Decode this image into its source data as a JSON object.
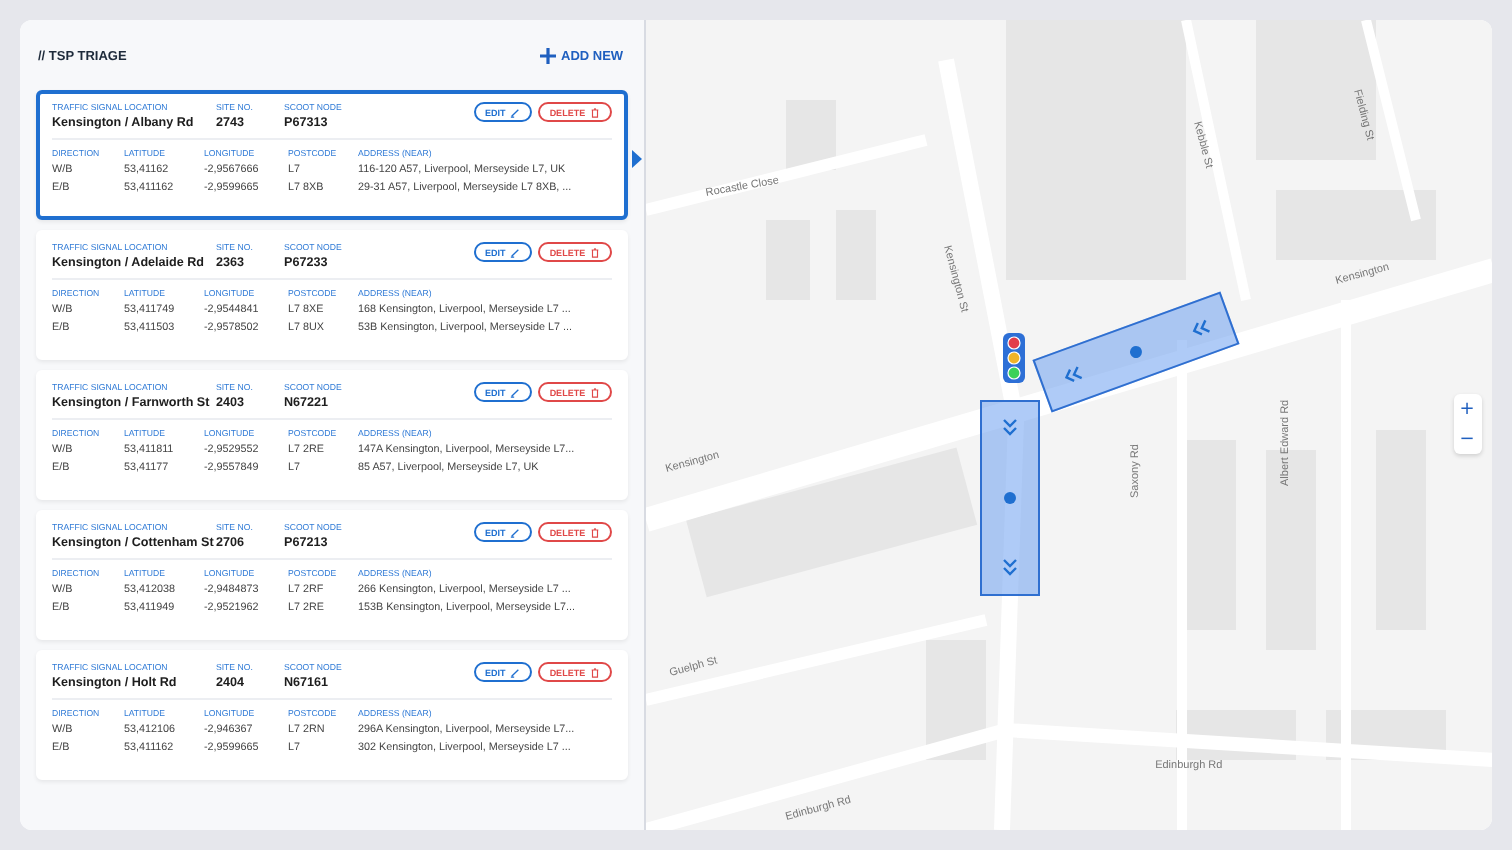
{
  "header": {
    "title": "// TSP TRIAGE",
    "add_label": "ADD NEW"
  },
  "cards": [
    {
      "selected": true,
      "fields": [
        {
          "label": "TRAFFIC SIGNAL LOCATION",
          "value": "Kensington / Albany Rd"
        },
        {
          "label": "SITE NO.",
          "value": "2743"
        },
        {
          "label": "SCOOT NODE",
          "value": "P67313"
        }
      ],
      "edit_label": "EDIT",
      "delete_label": "DELETE",
      "columns": [
        "DIRECTION",
        "LATITUDE",
        "LONGITUDE",
        "POSTCODE",
        "ADDRESS (NEAR)"
      ],
      "rows": [
        [
          "W/B",
          "53,41162",
          "-2,9567666",
          "L7",
          "116-120 A57, Liverpool, Merseyside L7, UK"
        ],
        [
          "E/B",
          "53,411162",
          "-2,9599665",
          "L7 8XB",
          "29-31 A57, Liverpool, Merseyside L7 8XB, ..."
        ]
      ]
    },
    {
      "selected": false,
      "fields": [
        {
          "label": "TRAFFIC SIGNAL LOCATION",
          "value": "Kensington / Adelaide Rd"
        },
        {
          "label": "SITE NO.",
          "value": "2363"
        },
        {
          "label": "SCOOT NODE",
          "value": "P67233"
        }
      ],
      "edit_label": "EDIT",
      "delete_label": "DELETE",
      "columns": [
        "DIRECTION",
        "LATITUDE",
        "LONGITUDE",
        "POSTCODE",
        "ADDRESS (NEAR)"
      ],
      "rows": [
        [
          "W/B",
          "53,411749",
          "-2,9544841",
          "L7 8XE",
          "168 Kensington, Liverpool, Merseyside L7 ..."
        ],
        [
          "E/B",
          "53,411503",
          "-2,9578502",
          "L7 8UX",
          "53B Kensington, Liverpool, Merseyside L7 ..."
        ]
      ]
    },
    {
      "selected": false,
      "fields": [
        {
          "label": "TRAFFIC SIGNAL LOCATION",
          "value": "Kensington / Farnworth St"
        },
        {
          "label": "SITE NO.",
          "value": "2403"
        },
        {
          "label": "SCOOT NODE",
          "value": "N67221"
        }
      ],
      "edit_label": "EDIT",
      "delete_label": "DELETE",
      "columns": [
        "DIRECTION",
        "LATITUDE",
        "LONGITUDE",
        "POSTCODE",
        "ADDRESS (NEAR)"
      ],
      "rows": [
        [
          "W/B",
          "53,411811",
          "-2,9529552",
          "L7 2RE",
          "147A Kensington, Liverpool, Merseyside L7..."
        ],
        [
          "E/B",
          "53,41177",
          "-2,9557849",
          "L7",
          "85 A57, Liverpool, Merseyside L7, UK"
        ]
      ]
    },
    {
      "selected": false,
      "fields": [
        {
          "label": "TRAFFIC SIGNAL LOCATION",
          "value": "Kensington / Cottenham St"
        },
        {
          "label": "SITE NO.",
          "value": "2706"
        },
        {
          "label": "SCOOT NODE",
          "value": "P67213"
        }
      ],
      "edit_label": "EDIT",
      "delete_label": "DELETE",
      "columns": [
        "DIRECTION",
        "LATITUDE",
        "LONGITUDE",
        "POSTCODE",
        "ADDRESS (NEAR)"
      ],
      "rows": [
        [
          "W/B",
          "53,412038",
          "-2,9484873",
          "L7 2RF",
          "266 Kensington, Liverpool, Merseyside L7 ..."
        ],
        [
          "E/B",
          "53,411949",
          "-2,9521962",
          "L7 2RE",
          "153B Kensington, Liverpool, Merseyside L7..."
        ]
      ]
    },
    {
      "selected": false,
      "fields": [
        {
          "label": "TRAFFIC SIGNAL LOCATION",
          "value": "Kensington / Holt Rd"
        },
        {
          "label": "SITE NO.",
          "value": "2404"
        },
        {
          "label": "SCOOT NODE",
          "value": "N67161"
        }
      ],
      "edit_label": "EDIT",
      "delete_label": "DELETE",
      "columns": [
        "DIRECTION",
        "LATITUDE",
        "LONGITUDE",
        "POSTCODE",
        "ADDRESS (NEAR)"
      ],
      "rows": [
        [
          "W/B",
          "53,412106",
          "-2,946367",
          "L7 2RN",
          "296A Kensington, Liverpool, Merseyside L7..."
        ],
        [
          "E/B",
          "53,411162",
          "-2,9599665",
          "L7",
          "302 Kensington, Liverpool, Merseyside L7 ..."
        ]
      ]
    }
  ],
  "map": {
    "street_labels": [
      "Rocastle Close",
      "Kensington St",
      "Kebble St",
      "Fielding St",
      "Kensington",
      "Kensington",
      "Saxony Rd",
      "Albert Edward Rd",
      "Guelph St",
      "Edinburgh Rd",
      "Edinburgh Rd"
    ],
    "zoom_in": "+",
    "zoom_out": "−"
  }
}
